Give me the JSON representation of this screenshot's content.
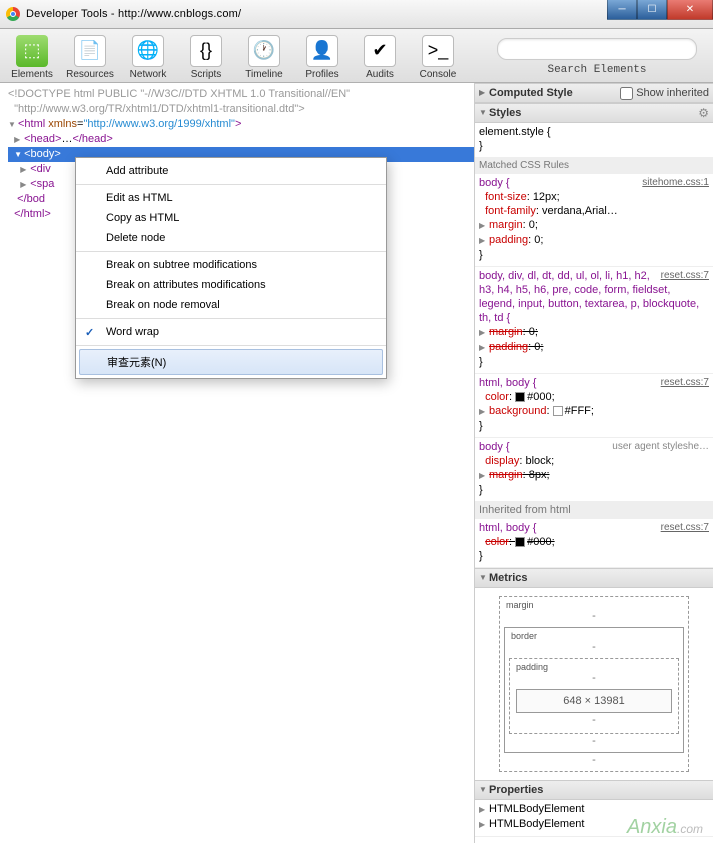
{
  "window": {
    "title": "Developer Tools - http://www.cnblogs.com/"
  },
  "toolbar": {
    "items": [
      {
        "label": "Elements"
      },
      {
        "label": "Resources"
      },
      {
        "label": "Network"
      },
      {
        "label": "Scripts"
      },
      {
        "label": "Timeline"
      },
      {
        "label": "Profiles"
      },
      {
        "label": "Audits"
      },
      {
        "label": "Console"
      }
    ],
    "search_placeholder": "",
    "search_label": "Search Elements"
  },
  "dom": {
    "doctype1": "<!DOCTYPE html PUBLIC \"-//W3C//DTD XHTML 1.0 Transitional//EN\"",
    "doctype2": "  \"http://www.w3.org/TR/xhtml1/DTD/xhtml1-transitional.dtd\">",
    "html_open": "<html xmlns=\"http://www.w3.org/1999/xhtml\">",
    "head": "<head>…</head>",
    "body_open": "<body>",
    "div": "<div",
    "span": "<spa",
    "body_close": "</bod",
    "html_close": "</html>"
  },
  "context_menu": {
    "items": [
      "Add attribute",
      "Edit as HTML",
      "Copy as HTML",
      "Delete node",
      "Break on subtree modifications",
      "Break on attributes modifications",
      "Break on node removal",
      "Word wrap",
      "审查元素(N)"
    ]
  },
  "styles": {
    "computed_hdr": "Computed Style",
    "show_inherited": "Show inherited",
    "styles_hdr": "Styles",
    "element_style_open": "element.style {",
    "close_brace": "}",
    "matched_hdr": "Matched CSS Rules",
    "rule1": {
      "sel": "body {",
      "link": "sitehome.css:1",
      "l1a": "font-size",
      "l1b": ": 12px;",
      "l2a": "font-family",
      "l2b": ": verdana,Arial…",
      "l3a": "margin",
      "l3b": ": 0;",
      "l4a": "padding",
      "l4b": ": 0;"
    },
    "rule2": {
      "sel": "body, div, dl, dt, dd, ul, ol, li, h1, h2, h3, h4, h5, h6, pre, code, form, fieldset, legend, input, button, textarea, p, blockquote, th, td {",
      "link": "reset.css:7",
      "l1a": "margin",
      "l1b": ": 0;",
      "l2a": "padding",
      "l2b": ": 0;"
    },
    "rule3": {
      "sel": "html, body {",
      "link": "reset.css:7",
      "l1a": "color",
      "l1b": ": ",
      "l1c": "#000;",
      "l2a": "background",
      "l2b": ": ",
      "l2c": "#FFF;"
    },
    "rule4": {
      "sel": "body {",
      "link": "user agent styleshe…",
      "l1a": "display",
      "l1b": ": block;",
      "l2a": "margin",
      "l2b": ": 8px;"
    },
    "inherited_hdr": "Inherited from html",
    "rule5": {
      "sel": "html, body {",
      "link": "reset.css:7",
      "l1a": "color",
      "l1b": ": ",
      "l1c": "#000;"
    },
    "metrics_hdr": "Metrics",
    "box": {
      "margin": "margin",
      "border": "border",
      "padding": "padding",
      "content": "648 × 13981"
    },
    "props_hdr": "Properties",
    "p1": "HTMLBodyElement",
    "p2": "HTMLBodyElement"
  },
  "watermark": {
    "a": "Anxia",
    "b": ".com"
  }
}
